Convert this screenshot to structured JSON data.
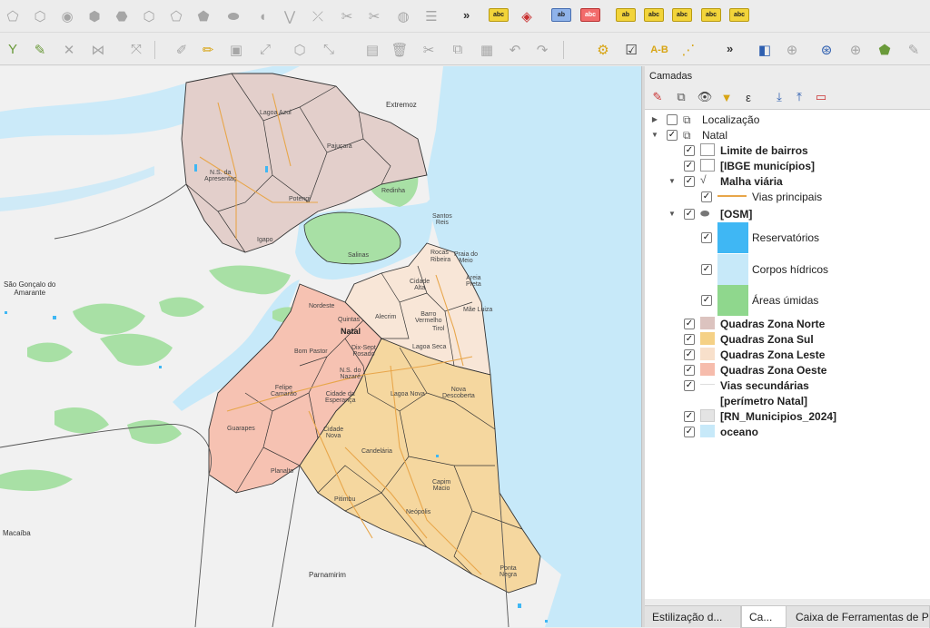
{
  "toolbar1": {
    "icons": [
      "digitize-polygon-icon",
      "reshape-icon",
      "vertex-icon",
      "add-ring-icon",
      "fill-ring-icon",
      "delete-ring-icon",
      "delete-part-icon",
      "reshape-features-icon",
      "offset-curve-icon",
      "simplify-icon",
      "split-features-icon",
      "split-parts-icon",
      "merge-icon",
      "rotate-icon",
      "align-icon"
    ],
    "more": "»",
    "labels": {
      "a": "abc",
      "b": "ab",
      "c": "abc",
      "d": "ab",
      "e": "abc",
      "f": "abc",
      "g": "abc"
    }
  },
  "toolbar2": {
    "more": "»",
    "icons": [
      "digitize-icon",
      "node-tool-icon",
      "delete-icon",
      "split-icon",
      "pencil-icon",
      "save-edits-icon",
      "move-feature-icon",
      "add-part-icon",
      "cut-icon",
      "copy-icon",
      "paste-icon",
      "undo-icon",
      "redo-icon",
      "processing-icon",
      "check-geometry-icon",
      "topology-checker-icon",
      "graph-icon",
      "identify-icon",
      "pan-to-selection-icon",
      "measure-icon",
      "geometry-icon",
      "vertex-editor-icon",
      "python-icon"
    ]
  },
  "map": {
    "colors": {
      "ocean": "#c7e9f9",
      "river": "#c7e9f9",
      "green": "#a8e0a5",
      "norte": "#e3cfcb",
      "sul": "#f5d79f",
      "leste": "#f8e6d7",
      "oeste": "#f6c2b2",
      "road": "#e8a64a",
      "boundary": "#333333"
    },
    "places": {
      "extremoz": "Extremoz",
      "lagoa_azul": "Lagoa Azul",
      "pajucara": "Pajuçara",
      "ns_apresentacao": "N.S. da\nApresentaç",
      "potengi": "Potengi",
      "redinha": "Redinha",
      "igapo": "Igapo",
      "santos_reis": "Santos\nReis",
      "salinas": "Salinas",
      "rocas": "Rocas",
      "ribeira": "Ribeira",
      "praia_meio": "Praia do\nMeio",
      "areia_preta": "Areia\nPreta",
      "cidade_alta": "Cidade\nAlta",
      "nordeste": "Nordeste",
      "quintas": "Quintas",
      "alecrim": "Alecrim",
      "barro_vermelho": "Barro\nVermelho",
      "tirol": "Tirol",
      "mae_luiza": "Mãe Luiza",
      "natal": "Natal",
      "lagoa_seca": "Lagoa Seca",
      "bom_pastor": "Bom Pastor",
      "dix_sept": "Dix-Sept\nRosado",
      "ns_nazare": "N.S. do\nNazaré",
      "felipe_camarao": "Felipe\nCamarão",
      "cidade_esperanca": "Cidade da\nEsperança",
      "lagoa_nova": "Lagoa Nova",
      "nova_descoberta": "Nova\nDescoberta",
      "guarapes": "Guarapes",
      "cidade_nova": "Cidade\nNova",
      "candelaria": "Candelária",
      "capim_macio": "Capim\nMacio",
      "planalto": "Planalto",
      "pitimbu": "Pitimbu",
      "neopolis": "Neópolis",
      "ponta_negra": "Ponta\nNegra",
      "sao_goncalo": "São Gonçalo do\nAmarante",
      "macaiba": "Macaíba",
      "parnamirim": "Parnamirim"
    }
  },
  "panel": {
    "title": "Camadas",
    "tool_icons": [
      "style-manager-icon",
      "add-group-icon",
      "manage-visibility-icon",
      "filter-legend-icon",
      "filter-expression-icon",
      "expand-all-icon",
      "collapse-all-icon",
      "remove-layer-icon"
    ],
    "layers": [
      {
        "label": "Localização",
        "bold": false,
        "checked": false,
        "indent": 0,
        "arrow": "▶",
        "symbol": "group-icon"
      },
      {
        "label": "Natal",
        "bold": false,
        "checked": true,
        "indent": 0,
        "arrow": "▼",
        "symbol": "group-icon"
      },
      {
        "label": "Limite de bairros",
        "bold": true,
        "checked": true,
        "indent": 1,
        "symbol": "fill-white"
      },
      {
        "label": "[IBGE municípios]",
        "bold": true,
        "checked": true,
        "indent": 1,
        "symbol": "fill-white"
      },
      {
        "label": "Malha viária",
        "bold": true,
        "checked": true,
        "indent": 1,
        "arrow": "▼",
        "symbol": "line-layer-icon"
      },
      {
        "label": "Vias principais",
        "bold": false,
        "checked": true,
        "indent": 2,
        "symbol": "line-orange"
      },
      {
        "label": "[OSM]",
        "bold": true,
        "checked": true,
        "indent": 1,
        "arrow": "▼",
        "symbol": "polygon-layer-icon"
      },
      {
        "label": "Reservatórios",
        "bold": false,
        "checked": true,
        "indent": 2,
        "symbol": "big-fill",
        "color": "#3fb7f4"
      },
      {
        "label": "Corpos hídricos",
        "bold": false,
        "checked": true,
        "indent": 2,
        "symbol": "big-fill",
        "color": "#c7e9f9"
      },
      {
        "label": "Áreas úmidas",
        "bold": false,
        "checked": true,
        "indent": 2,
        "symbol": "big-fill",
        "color": "#8fd78d"
      },
      {
        "label": "Quadras Zona Norte",
        "bold": true,
        "checked": true,
        "indent": 1,
        "symbol": "fill",
        "color": "#dcc3bf"
      },
      {
        "label": "Quadras Zona Sul",
        "bold": true,
        "checked": true,
        "indent": 1,
        "symbol": "fill",
        "color": "#f5d186"
      },
      {
        "label": "Quadras Zona Leste",
        "bold": true,
        "checked": true,
        "indent": 1,
        "symbol": "fill",
        "color": "#f8e0cb"
      },
      {
        "label": "Quadras Zona Oeste",
        "bold": true,
        "checked": true,
        "indent": 1,
        "symbol": "fill",
        "color": "#f6bcac"
      },
      {
        "label": "Vias secundárias",
        "bold": true,
        "checked": true,
        "indent": 1,
        "symbol": "line-light"
      },
      {
        "label": "[perímetro Natal]",
        "bold": true,
        "checked": false,
        "indent": 1,
        "symbol": "none"
      },
      {
        "label": "[RN_Municipios_2024]",
        "bold": true,
        "checked": true,
        "indent": 1,
        "symbol": "fill",
        "color": "#e4e4e4"
      },
      {
        "label": "oceano",
        "bold": true,
        "checked": true,
        "indent": 1,
        "symbol": "fill",
        "color": "#c7e9f9"
      }
    ],
    "tabs": [
      {
        "label": "Estilização d...",
        "active": false
      },
      {
        "label": "Ca...",
        "active": true
      },
      {
        "label": "Caixa de Ferramentas de P",
        "active": false
      }
    ]
  }
}
